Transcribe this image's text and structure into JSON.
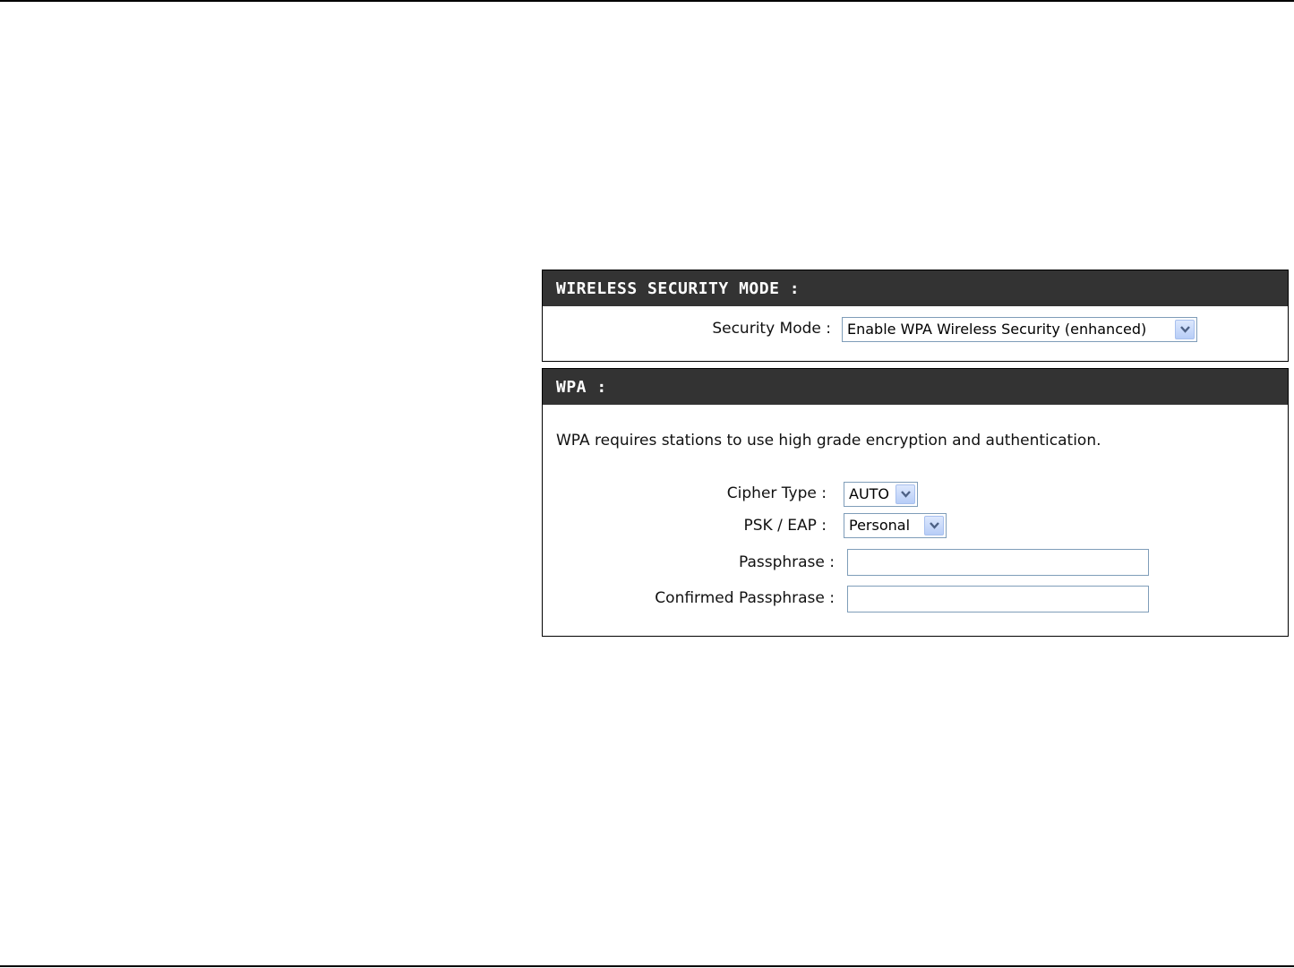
{
  "wireless_security_mode": {
    "title": "WIRELESS SECURITY MODE :",
    "security_mode_label": "Security Mode :",
    "security_mode_value": "Enable WPA Wireless Security (enhanced)"
  },
  "wpa": {
    "title": "WPA :",
    "description": "WPA requires stations to use high grade encryption and authentication.",
    "cipher_type_label": "Cipher Type :",
    "cipher_type_value": "AUTO",
    "psk_eap_label": "PSK / EAP :",
    "psk_eap_value": "Personal",
    "passphrase_label": "Passphrase :",
    "passphrase_value": "",
    "confirmed_passphrase_label": "Confirmed Passphrase :",
    "confirmed_passphrase_value": ""
  },
  "icons": {
    "dropdown": "chevron-down-icon"
  },
  "colors": {
    "header_bg": "#333333",
    "header_text": "#ffffff",
    "field_border": "#7f9db9",
    "arrow_bg": "#c6d7fa",
    "arrow_glyph": "#4d6185"
  }
}
